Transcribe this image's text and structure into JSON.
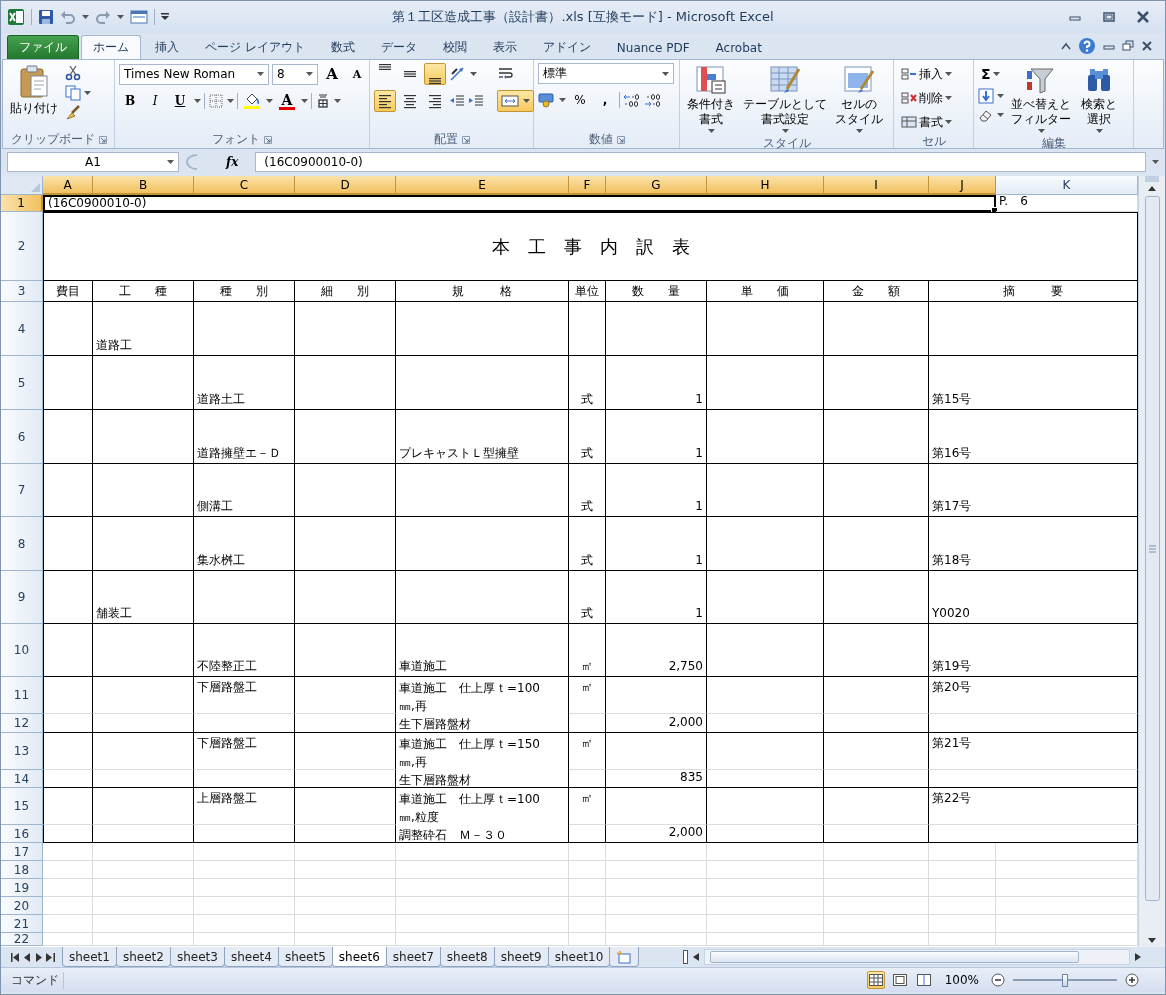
{
  "title_bar": {
    "title": "第１工区造成工事（設計書）.xls  [互換モード] - Microsoft Excel"
  },
  "ribbon_tabs": [
    {
      "label": "ファイル",
      "kind": "file",
      "selected": false
    },
    {
      "label": "ホーム",
      "kind": "tab",
      "selected": true
    },
    {
      "label": "挿入",
      "kind": "tab",
      "selected": false
    },
    {
      "label": "ページ レイアウト",
      "kind": "tab",
      "selected": false
    },
    {
      "label": "数式",
      "kind": "tab",
      "selected": false
    },
    {
      "label": "データ",
      "kind": "tab",
      "selected": false
    },
    {
      "label": "校閲",
      "kind": "tab",
      "selected": false
    },
    {
      "label": "表示",
      "kind": "tab",
      "selected": false
    },
    {
      "label": "アドイン",
      "kind": "tab",
      "selected": false
    },
    {
      "label": "Nuance PDF",
      "kind": "tab",
      "selected": false
    },
    {
      "label": "Acrobat",
      "kind": "tab",
      "selected": false
    }
  ],
  "ribbon": {
    "clipboard": {
      "paste": "貼り付け",
      "label": "クリップボード"
    },
    "font": {
      "name": "Times New Roman",
      "size": "8",
      "grow": "A",
      "shrink": "A",
      "bold": "B",
      "italic": "I",
      "underline": "U",
      "font_color": "A",
      "label": "フォント"
    },
    "alignment": {
      "vertical": [
        {
          "selected": false
        },
        {
          "selected": false
        },
        {
          "selected": true
        }
      ],
      "horizontal": [
        {
          "selected": true
        },
        {
          "selected": false
        },
        {
          "selected": false
        }
      ],
      "merge": {
        "selected": true
      },
      "label": "配置"
    },
    "number": {
      "format": "標準",
      "percent": "%",
      "comma": ",",
      "label": "数値"
    },
    "styles": {
      "buttons": [
        [
          "条件付き",
          "書式"
        ],
        [
          "テーブルとして",
          "書式設定"
        ],
        [
          "セルの",
          "スタイル"
        ]
      ],
      "label": "スタイル"
    },
    "cells": {
      "buttons": [
        "挿入",
        "削除",
        "書式"
      ],
      "label": "セル"
    },
    "editing": {
      "sum": "Σ",
      "buttons": [
        [
          "並べ替えと",
          "フィルター"
        ],
        [
          "検索と",
          "選択"
        ]
      ],
      "label": "編集"
    }
  },
  "formula_bar": {
    "name_box": "A1",
    "fx": "fx",
    "formula": "(16C0900010-0)"
  },
  "sheet": {
    "columns": [
      {
        "label": "A",
        "selected": true
      },
      {
        "label": "B",
        "selected": true
      },
      {
        "label": "C",
        "selected": true
      },
      {
        "label": "D",
        "selected": true
      },
      {
        "label": "E",
        "selected": true
      },
      {
        "label": "F",
        "selected": true
      },
      {
        "label": "G",
        "selected": true
      },
      {
        "label": "H",
        "selected": true
      },
      {
        "label": "I",
        "selected": true
      },
      {
        "label": "J",
        "selected": true
      },
      {
        "label": "K",
        "selected": false
      }
    ],
    "rows": [
      {
        "number": "1",
        "selected": true,
        "kind": "id",
        "cells": {
          "A": "(16C0900010-0)",
          "K": "P.　6"
        }
      },
      {
        "number": "2",
        "selected": false,
        "kind": "title",
        "cells": {
          "A": "本　工　事　内　訳　表"
        }
      },
      {
        "number": "3",
        "selected": false,
        "kind": "header",
        "cells": {
          "A": "費目",
          "B": "工　　種",
          "C": "種　　別",
          "D": "細　　別",
          "E": "規　　　格",
          "F": "単位",
          "G": "数　　量",
          "H": "単　　価",
          "I": "金　　額",
          "J": "摘　　　要"
        }
      },
      {
        "number": "4",
        "selected": false,
        "kind": "item",
        "cells": {
          "B": "道路工"
        }
      },
      {
        "number": "5",
        "selected": false,
        "kind": "item",
        "cells": {
          "C": "道路土工",
          "F": "式",
          "G": "1",
          "J": "第15号"
        }
      },
      {
        "number": "6",
        "selected": false,
        "kind": "item",
        "cells": {
          "C": "道路擁壁エ－Ｄ",
          "E": "プレキャストＬ型擁壁",
          "F": "式",
          "G": "1",
          "J": "第16号"
        }
      },
      {
        "number": "7",
        "selected": false,
        "kind": "item",
        "cells": {
          "C": "側溝工",
          "F": "式",
          "G": "1",
          "J": "第17号"
        }
      },
      {
        "number": "8",
        "selected": false,
        "kind": "item",
        "cells": {
          "C": "集水桝工",
          "F": "式",
          "G": "1",
          "J": "第18号"
        }
      },
      {
        "number": "9",
        "selected": false,
        "kind": "item",
        "cells": {
          "B": "舗装工",
          "F": "式",
          "G": "1",
          "J": "Y0020"
        }
      },
      {
        "number": "10",
        "selected": false,
        "kind": "item",
        "cells": {
          "C": "不陸整正工",
          "E": "車道施工",
          "F": "㎡",
          "G": "2,750",
          "J": "第19号"
        }
      },
      {
        "number": "11",
        "selected": false,
        "kind": "item",
        "cells": {
          "C": "下層路盤工",
          "E": [
            "車道施工　仕上厚ｔ=100",
            "㎜,再",
            "生下層路盤材"
          ],
          "F": "㎡",
          "J": "第20号"
        }
      },
      {
        "number": "12",
        "selected": false,
        "kind": "continued",
        "cells": {
          "G": "2,000"
        }
      },
      {
        "number": "13",
        "selected": false,
        "kind": "item",
        "cells": {
          "C": "下層路盤工",
          "E": [
            "車道施工　仕上厚ｔ=150",
            "㎜,再",
            "生下層路盤材"
          ],
          "F": "㎡",
          "J": "第21号"
        }
      },
      {
        "number": "14",
        "selected": false,
        "kind": "continued",
        "cells": {
          "G": "835"
        }
      },
      {
        "number": "15",
        "selected": false,
        "kind": "item",
        "cells": {
          "C": "上層路盤工",
          "E": [
            "車道施工　仕上厚ｔ=100",
            "㎜,粒度",
            "調整砕石　Ｍ－３０"
          ],
          "F": "㎡",
          "J": "第22号"
        }
      },
      {
        "number": "16",
        "selected": false,
        "kind": "continued",
        "cells": {
          "G": "2,000"
        }
      },
      {
        "number": "17",
        "selected": false,
        "kind": "blank"
      },
      {
        "number": "18",
        "selected": false,
        "kind": "blank"
      },
      {
        "number": "19",
        "selected": false,
        "kind": "blank"
      },
      {
        "number": "20",
        "selected": false,
        "kind": "blank"
      },
      {
        "number": "21",
        "selected": false,
        "kind": "blank"
      },
      {
        "number": "22",
        "selected": false,
        "kind": "blank"
      }
    ]
  },
  "sheet_tabs": [
    {
      "label": "sheet1",
      "selected": false
    },
    {
      "label": "sheet2",
      "selected": false
    },
    {
      "label": "sheet3",
      "selected": false
    },
    {
      "label": "sheet4",
      "selected": false
    },
    {
      "label": "sheet5",
      "selected": false
    },
    {
      "label": "sheet6",
      "selected": true
    },
    {
      "label": "sheet7",
      "selected": false
    },
    {
      "label": "sheet8",
      "selected": false
    },
    {
      "label": "sheet9",
      "selected": false
    },
    {
      "label": "sheet10",
      "selected": false
    }
  ],
  "status_bar": {
    "mode": "コマンド",
    "views": [
      {
        "selected": true
      },
      {
        "selected": false
      },
      {
        "selected": false
      }
    ],
    "zoom": "100%",
    "zoom_slider": {
      "level": 0.5
    }
  }
}
